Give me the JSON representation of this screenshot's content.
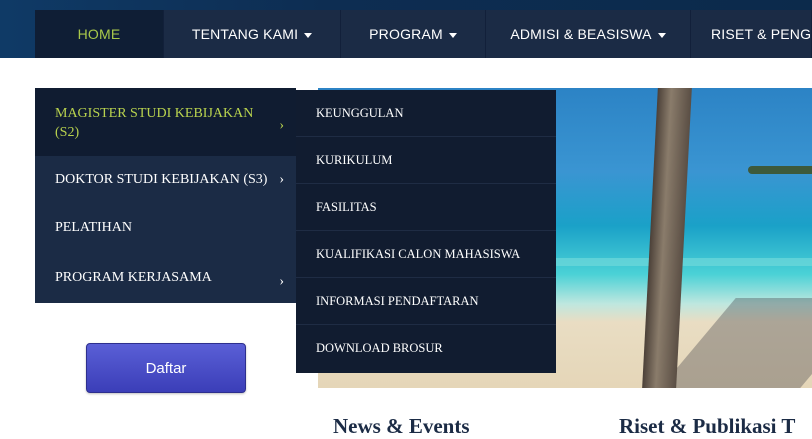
{
  "nav": {
    "items": [
      {
        "label": "HOME",
        "active": true,
        "dropdown": false
      },
      {
        "label": "TENTANG KAMI",
        "active": false,
        "dropdown": true
      },
      {
        "label": "PROGRAM",
        "active": false,
        "dropdown": true
      },
      {
        "label": "ADMISI & BEASISWA",
        "active": false,
        "dropdown": true
      },
      {
        "label": "RISET & PENG",
        "active": false,
        "dropdown": false
      }
    ]
  },
  "submenu": {
    "items": [
      {
        "label": "MAGISTER STUDI KEBIJAKAN (S2)",
        "active": true,
        "chevron": "›"
      },
      {
        "label": "DOKTOR STUDI KEBIJAKAN (S3)",
        "active": false,
        "chevron": "›"
      },
      {
        "label": "PELATIHAN",
        "active": false,
        "chevron": ""
      },
      {
        "label": "PROGRAM KERJASAMA",
        "active": false,
        "chevron": "›"
      }
    ]
  },
  "flyout": {
    "items": [
      "KEUNGGULAN",
      "KURIKULUM",
      "FASILITAS",
      "KUALIFIKASI CALON MAHASISWA",
      "INFORMASI PENDAFTARAN",
      "DOWNLOAD BROSUR"
    ]
  },
  "daftar_label": "Daftar",
  "headings": {
    "news": "News & Events",
    "riset": "Riset & Publikasi T"
  },
  "slider": {
    "active_dot_color": "#9bd14a",
    "dot_color": "#ffffff"
  },
  "colors": {
    "nav_bg": "#1b2b45",
    "accent": "#a8c84a",
    "button": "#4a4fcc"
  }
}
